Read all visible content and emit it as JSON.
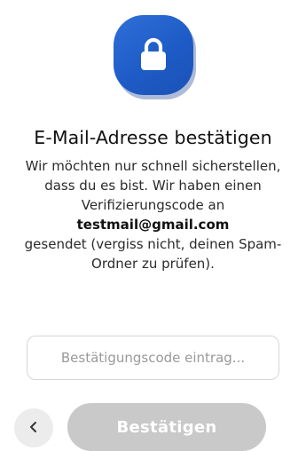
{
  "header": {
    "icon": "lock-icon",
    "icon_color": "#1e5bc6"
  },
  "title": "E-Mail-Adresse bestätigen",
  "description": {
    "line1": "Wir möchten nur schnell sicherstellen, dass du es bist. Wir haben einen Verifizierungscode an",
    "email": "testmail@gmail.com",
    "line2": "gesendet (vergiss nicht, deinen Spam-Ordner zu prüfen)."
  },
  "code_input": {
    "placeholder": "Bestätigungscode eintrag...",
    "value": ""
  },
  "actions": {
    "back_icon": "chevron-left-icon",
    "confirm_label": "Bestätigen",
    "confirm_color": "#c9c9c9"
  }
}
